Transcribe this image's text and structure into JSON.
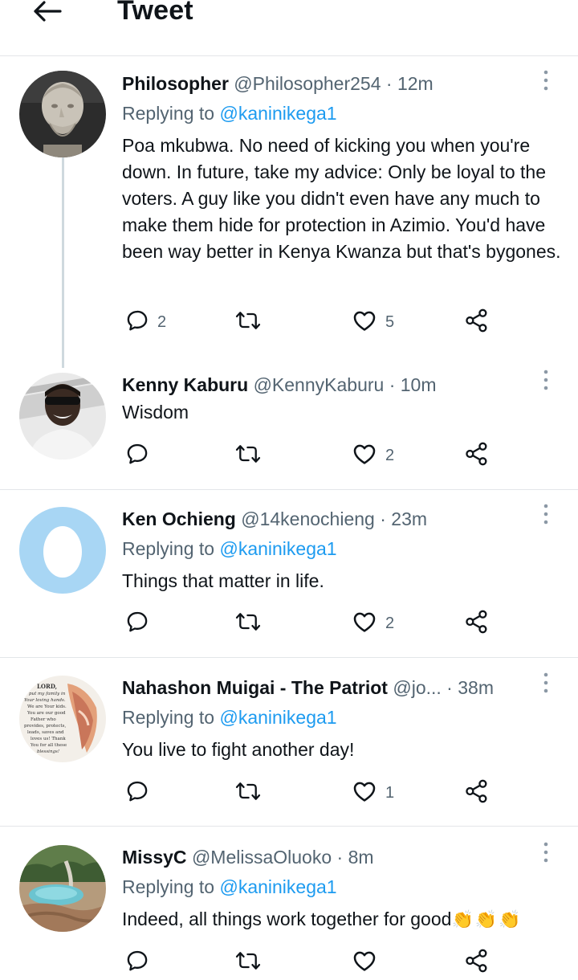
{
  "header": {
    "title": "Tweet",
    "back_icon": "arrow-left-icon"
  },
  "tweets": [
    {
      "name": "Philosopher",
      "handle": "@Philosopher254",
      "sep": "·",
      "time": "12m",
      "reply_label": "Replying to",
      "reply_to": "@kaninikega1",
      "text": "Poa mkubwa. No need of kicking you when you're down. In future, take my advice: Only be loyal to the voters. A guy like you didn't even have any much to make them hide for protection in Azimio. You'd have been way better in Kenya Kwanza but that's bygones.",
      "replies": "2",
      "retweets": "",
      "likes": "5"
    },
    {
      "name": "Kenny Kaburu",
      "handle": "@KennyKaburu",
      "sep": "·",
      "time": "10m",
      "text": "Wisdom",
      "replies": "",
      "retweets": "",
      "likes": "2"
    },
    {
      "name": "Ken Ochieng",
      "handle": "@14kenochieng",
      "sep": "·",
      "time": "23m",
      "reply_label": "Replying to",
      "reply_to": "@kaninikega1",
      "text": "Things that matter in life.",
      "replies": "",
      "retweets": "",
      "likes": "2"
    },
    {
      "name": "Nahashon Muigai - The Patriot",
      "handle": "@jo...",
      "sep": "·",
      "time": "38m",
      "reply_label": "Replying to",
      "reply_to": "@kaninikega1",
      "text": "You live to fight another day!",
      "replies": "",
      "retweets": "",
      "likes": "1",
      "avatar_text": [
        "LORD,",
        "put my family in",
        "Your loving hands.",
        "We are Your kids.",
        "You are our good",
        "Father who",
        "provides, protects,",
        "leads, saves and",
        "loves us! Thank",
        "You for all these",
        "blessings!"
      ]
    },
    {
      "name": "MissyC",
      "handle": "@MelissaOluoko",
      "sep": "·",
      "time": "8m",
      "reply_label": "Replying to",
      "reply_to": "@kaninikega1",
      "text": "Indeed, all things work together for good",
      "emoji": "👏👏👏",
      "replies": "",
      "retweets": "",
      "likes": ""
    }
  ],
  "icons": {
    "reply": "speech-bubble-icon",
    "retweet": "retweet-icon",
    "like": "heart-icon",
    "share": "share-icon",
    "more": "more-vertical-icon"
  },
  "colors": {
    "text_primary": "#0f1419",
    "text_secondary": "#536471",
    "mention": "#1d9bf0",
    "divider": "#e3e6e9",
    "thread_line": "#cfd9de"
  }
}
